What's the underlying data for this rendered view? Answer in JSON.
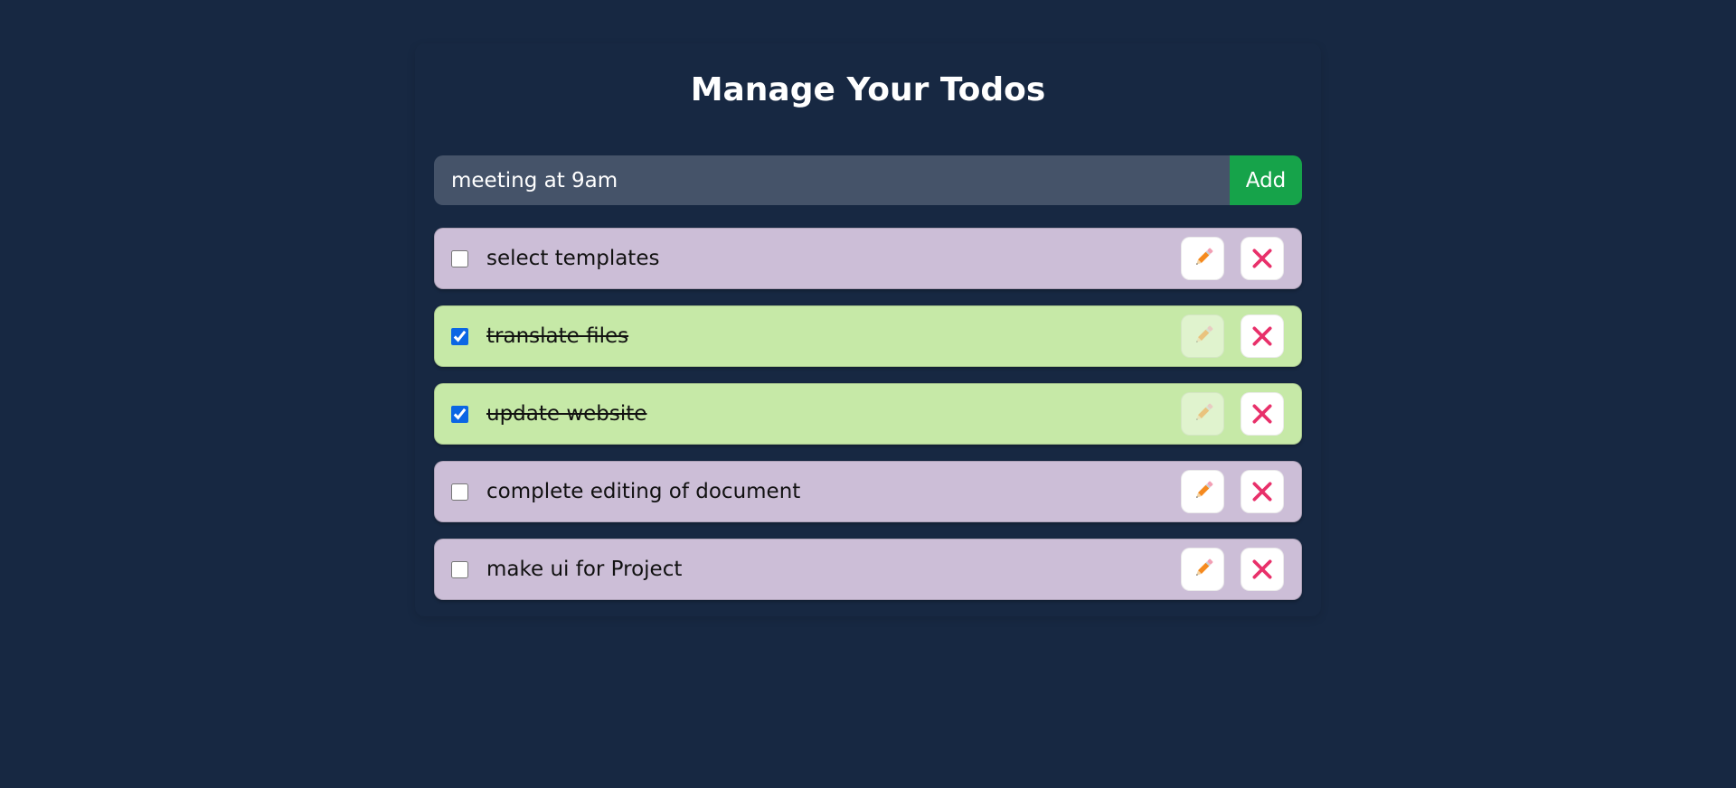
{
  "header": {
    "title": "Manage Your Todos"
  },
  "add_form": {
    "input_value": "meeting at 9am",
    "add_label": "Add"
  },
  "colors": {
    "background": "#172842",
    "pending_item": "#ccbed7",
    "completed_item": "#c6e9a7",
    "add_button": "#16a34a",
    "input_background": "#455369"
  },
  "icons": {
    "edit": "pencil-icon",
    "delete": "cross-mark-icon"
  },
  "todos": [
    {
      "text": "select templates",
      "completed": false
    },
    {
      "text": "translate files",
      "completed": true
    },
    {
      "text": "update website",
      "completed": true
    },
    {
      "text": "complete editing of document",
      "completed": false
    },
    {
      "text": "make ui for Project",
      "completed": false
    }
  ]
}
